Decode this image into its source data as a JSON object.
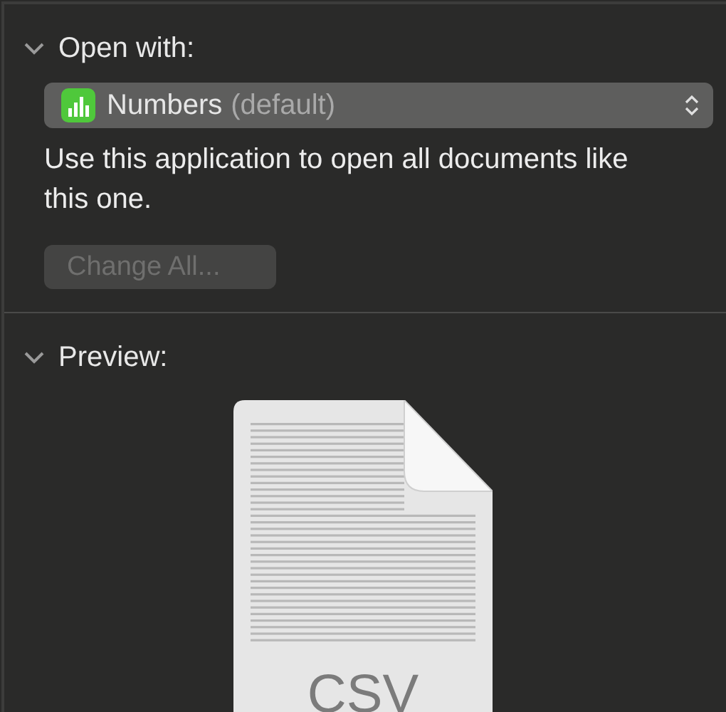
{
  "sections": [
    {
      "kind": "open_with",
      "title": "Open with:",
      "expanded": true,
      "app": {
        "name": "Numbers",
        "note": "(default)"
      },
      "description": "Use this application to open all documents like this one.",
      "button": {
        "label": "Change All...",
        "disabled": true
      }
    },
    {
      "kind": "preview",
      "title": "Preview:",
      "expanded": true,
      "file_type": "CSV"
    }
  ]
}
